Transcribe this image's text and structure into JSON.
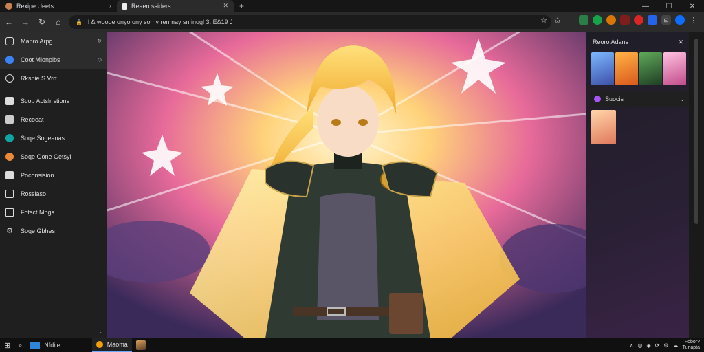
{
  "browser": {
    "tabs": [
      {
        "label": "Rexipe Ueets",
        "active": false
      },
      {
        "label": "Reaen ssiders",
        "active": true
      }
    ],
    "new_tab_icon": "plus-icon",
    "address": "l & woooe onyo ony sorny renmay sn inogl 3. E&19 J"
  },
  "sidebar": {
    "items": [
      {
        "label": "Mapro Arpg",
        "icon": "box-icon"
      },
      {
        "label": "Coot Mionpibs",
        "icon": "globe-icon"
      },
      {
        "label": "Rkspie S Vrrt",
        "icon": "circle-icon"
      },
      {
        "label": "Scop Actslr stions",
        "icon": "page-icon"
      },
      {
        "label": "Recoeat",
        "icon": "folder-icon"
      },
      {
        "label": "Soqe Sogeanas",
        "icon": "globe-icon"
      },
      {
        "label": "Soqe Gone Getsyl",
        "icon": "orange-icon"
      },
      {
        "label": "Poconsision",
        "icon": "doc-icon"
      },
      {
        "label": "Rossiaso",
        "icon": "image-icon"
      },
      {
        "label": "Fotsct Mhgs",
        "icon": "frame-icon"
      },
      {
        "label": "Soqe Gbhes",
        "icon": "gear-icon"
      }
    ]
  },
  "right_panel": {
    "title": "Reoro Adans",
    "select_label": "Suocis"
  },
  "taskbar": {
    "search_label": "Nfdite",
    "app_label": "Maoma",
    "clock_top": "Fobor?",
    "clock_bottom": "Tunapta"
  },
  "colors": {
    "accent": "#6aa9ff",
    "bg": "#202124"
  }
}
